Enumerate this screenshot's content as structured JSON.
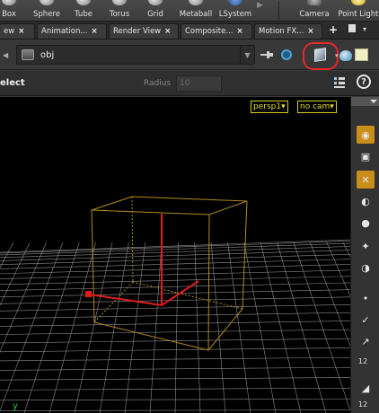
{
  "shelf": {
    "tools": [
      {
        "name": "box",
        "label": "Box"
      },
      {
        "name": "sphere",
        "label": "Sphere"
      },
      {
        "name": "tube",
        "label": "Tube"
      },
      {
        "name": "torus",
        "label": "Torus"
      },
      {
        "name": "grid",
        "label": "Grid"
      },
      {
        "name": "metaball",
        "label": "Metaball"
      },
      {
        "name": "lsystem",
        "label": "LSystem"
      },
      {
        "name": "camera",
        "label": "Camera"
      },
      {
        "name": "point-light",
        "label": "Point Light"
      }
    ],
    "overflow_arrow": "▶"
  },
  "tabs": {
    "items": [
      {
        "label": "ew",
        "close": "×"
      },
      {
        "label": "Animation...",
        "close": "×"
      },
      {
        "label": "Render View",
        "close": "×"
      },
      {
        "label": "Composite...",
        "close": "×"
      },
      {
        "label": "Motion FX...",
        "close": "×"
      }
    ],
    "add": "+",
    "more_caret": "▾"
  },
  "pathbar": {
    "back_arrow": "◀",
    "path": "obj",
    "dropdown_caret": "▼"
  },
  "opbar": {
    "title": "elect",
    "radius_label": "Radius",
    "radius_value": "10"
  },
  "viewport": {
    "camera_menu": "persp1▾",
    "cam_menu": "no cam▾",
    "axis_label": "y",
    "background": "#000000",
    "grid_color": "#8c8c8c",
    "bbox_color": "#b08a1a",
    "handle_color": "#e01c1c"
  },
  "right_toolbar": {
    "numbers": [
      "12",
      "12"
    ]
  },
  "colors": {
    "highlight_ring": "#e82727",
    "active_button": "#c98d1a",
    "vp_label": "#e3dc2c"
  }
}
